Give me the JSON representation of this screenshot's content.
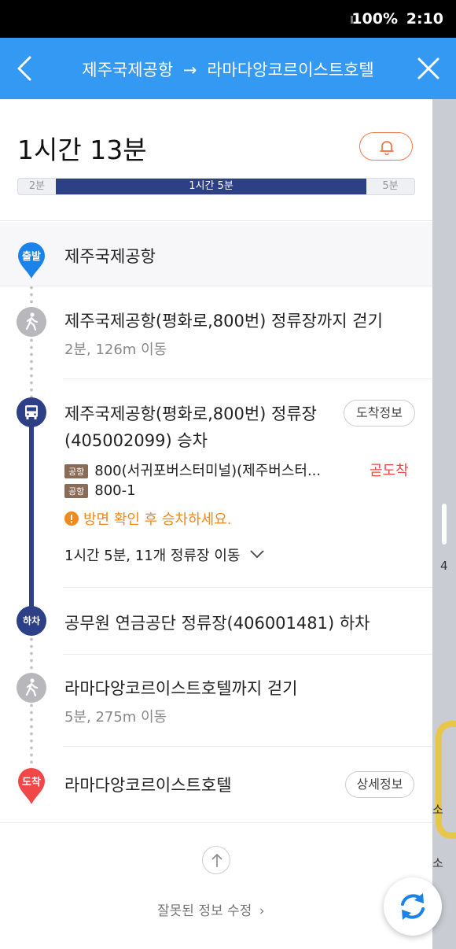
{
  "status_bar": {
    "battery": "100%",
    "time": "2:10"
  },
  "header": {
    "from": "제주국제공항",
    "arrow": "→",
    "to": "라마다앙코르이스트호텔"
  },
  "summary": {
    "duration": "1시간 13분",
    "segments": [
      {
        "label": "2분",
        "mode": "walk"
      },
      {
        "label": "1시간 5분",
        "mode": "bus",
        "color": "#2d3f86"
      },
      {
        "label": "5분",
        "mode": "walk"
      }
    ]
  },
  "route": {
    "origin": {
      "badge": "출발",
      "name": "제주국제공항",
      "color": "#1a82e8"
    },
    "walk1": {
      "title": "제주국제공항(평화로,800번) 정류장까지 걷기",
      "sub": "2분, 126m 이동"
    },
    "board": {
      "title_line1": "제주국제공항(평화로,800번) 정류장",
      "title_line2": "(405002099) 승차",
      "info_button": "도착정보",
      "buses": [
        {
          "tag": "공항",
          "name": "800(서귀포버스터미널)(제주버스터...",
          "status": "곧도착"
        },
        {
          "tag": "공항",
          "name": "800-1",
          "status": ""
        }
      ],
      "warning": "방면 확인 후 승차하세요.",
      "summary": "1시간 5분, 11개 정류장 이동"
    },
    "alight": {
      "badge": "하차",
      "title": "공무원 연금공단 정류장(406001481) 하차"
    },
    "walk2": {
      "title": "라마다앙코르이스트호텔까지 걷기",
      "sub": "5분, 275m 이동"
    },
    "destination": {
      "badge": "도착",
      "name": "라마다앙코르이스트호텔",
      "detail_button": "상세정보",
      "color": "#f04848"
    }
  },
  "footer": {
    "report_link": "잘못된 정보 수정",
    "chevron": "›"
  },
  "map": {
    "labels": [
      "4",
      "소",
      "소"
    ]
  },
  "colors": {
    "accent": "#3399f3",
    "bus": "#2d3f86",
    "warning": "#f08a1c",
    "arrival": "#f04848"
  }
}
